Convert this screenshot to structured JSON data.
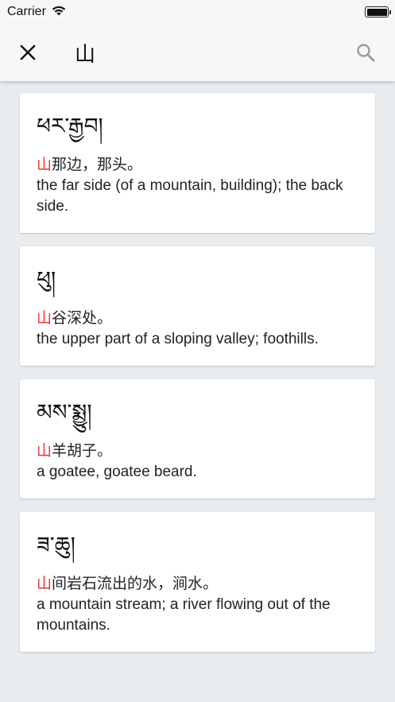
{
  "status_bar": {
    "carrier": "Carrier"
  },
  "header": {
    "query": "山"
  },
  "colors": {
    "highlight": "#e53935",
    "icon": "#9a9a9a"
  },
  "results": [
    {
      "term": "ཕར་རྒྱབ།",
      "zh_highlight": "山",
      "zh_rest": "那边，那头。",
      "en": "the far side (of a mountain, building); the back side."
    },
    {
      "term": "ཕུ།",
      "zh_highlight": "山",
      "zh_rest": "谷深处。",
      "en": "the upper part of a sloping valley; foothills."
    },
    {
      "term": "མས་སྨྱུ།",
      "zh_highlight": "山",
      "zh_rest": "羊胡子。",
      "en": "a goatee, goatee beard."
    },
    {
      "term": "ཟ་ཆུ།",
      "zh_highlight": "山",
      "zh_rest": "间岩石流出的水，涧水。",
      "en": "a mountain stream; a river flowing out of the mountains."
    }
  ]
}
